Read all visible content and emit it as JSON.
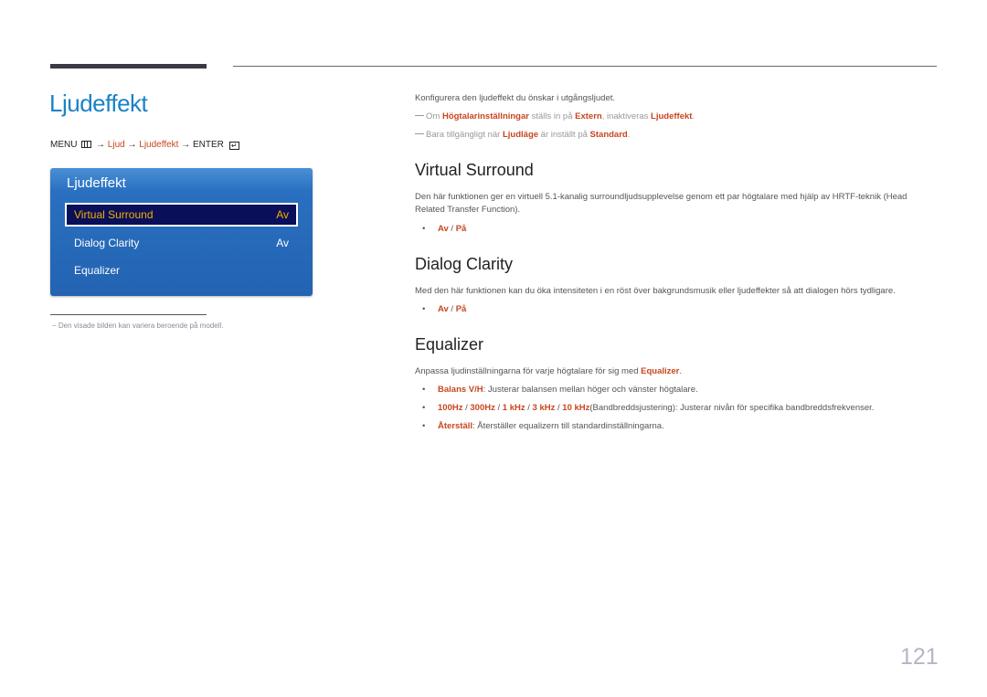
{
  "page_title": "Ljudeffekt",
  "breadcrumb": {
    "menu": "MENU",
    "menu_icon": "menu-icon",
    "arrow": "→",
    "step1": "Ljud",
    "step2": "Ljudeffekt",
    "enter": "ENTER",
    "enter_icon": "enter-icon"
  },
  "osd": {
    "title": "Ljudeffekt",
    "items": [
      {
        "label": "Virtual Surround",
        "value": "Av",
        "selected": true
      },
      {
        "label": "Dialog Clarity",
        "value": "Av",
        "selected": false
      },
      {
        "label": "Equalizer",
        "value": "",
        "selected": false
      }
    ]
  },
  "footnote": "−  Den visade bilden kan variera beroende på modell.",
  "intro": {
    "text": "Konfigurera den ljudeffekt du önskar i utgångsljudet.",
    "note1": {
      "pre": "Om ",
      "b1": "Högtalarinställningar",
      "mid": " ställs in på ",
      "b2": "Extern",
      "mid2": ", inaktiveras ",
      "b3": "Ljudeffekt",
      "post": "."
    },
    "note2": {
      "pre": "Bara tillgängligt när ",
      "b1": "Ljudläge",
      "mid": " är inställt på ",
      "b2": "Standard",
      "post": "."
    }
  },
  "sections": {
    "virtual_surround": {
      "heading": "Virtual Surround",
      "line1": "Den här funktionen ger en virtuell 5.1-kanalig surroundljudsupplevelse genom ett par högtalare med hjälp av HRTF-teknik (Head",
      "line2": "Related Transfer Function).",
      "opt_off": "Av",
      "sep": " / ",
      "opt_on": "På"
    },
    "dialog_clarity": {
      "heading": "Dialog Clarity",
      "line1": "Med den här funktionen kan du öka intensiteten i en röst över bakgrundsmusik eller ljudeffekter så att dialogen hörs tydligare.",
      "opt_off": "Av",
      "sep": " / ",
      "opt_on": "På"
    },
    "equalizer": {
      "heading": "Equalizer",
      "intro_pre": "Anpassa ljudinställningarna för varje högtalare för sig med ",
      "intro_b": "Equalizer",
      "intro_post": ".",
      "b1_label": "Balans V/H",
      "b1_text": ": Justerar balansen mellan höger och vänster högtalare.",
      "freqs": [
        "100Hz",
        "300Hz",
        "1 kHz",
        "3 kHz",
        "10 kHz"
      ],
      "freq_sep": " / ",
      "b2_text": "(Bandbreddsjustering): Justerar nivån för specifika bandbreddsfrekvenser.",
      "b3_label": "Återställ",
      "b3_text": ": Återställer equalizern till standardinställningarna."
    }
  },
  "page_number": "121",
  "colors": {
    "title_blue": "#1a82c6",
    "highlight_orange": "#c8461e",
    "osd_blue": "#2363b2",
    "osd_selected": "#0a0f5a",
    "osd_selected_text": "#f0b000"
  }
}
